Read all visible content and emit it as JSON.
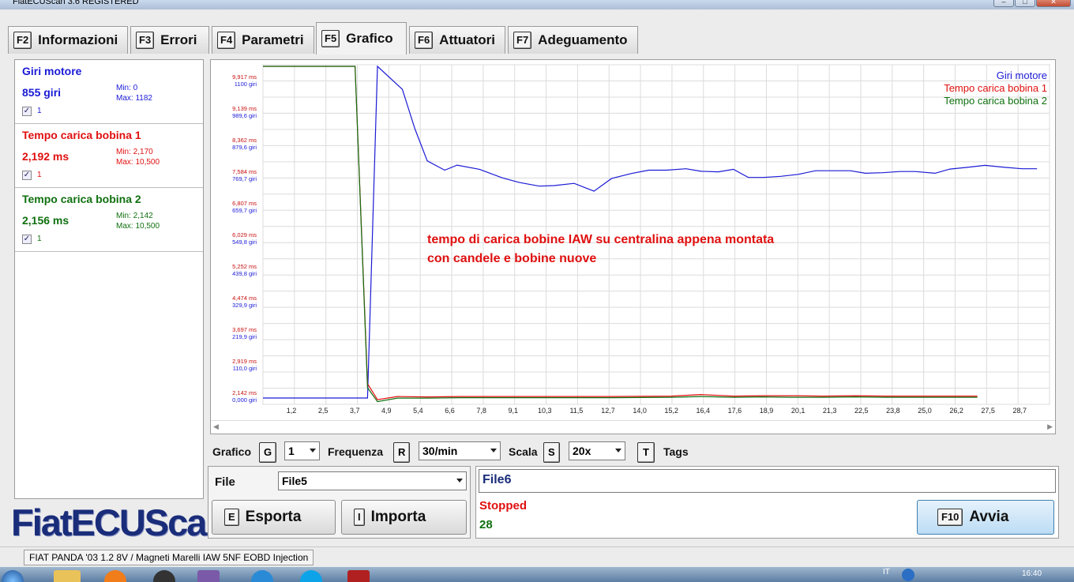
{
  "window": {
    "title": "FiatECUScan 3.6 REGISTERED",
    "min": "–",
    "max": "□",
    "close": "✕"
  },
  "tabs": [
    {
      "key": "F2",
      "label": "Informazioni"
    },
    {
      "key": "F3",
      "label": "Errori"
    },
    {
      "key": "F4",
      "label": "Parametri"
    },
    {
      "key": "F5",
      "label": "Grafico"
    },
    {
      "key": "F6",
      "label": "Attuatori"
    },
    {
      "key": "F7",
      "label": "Adeguamento"
    }
  ],
  "sensors": [
    {
      "name": "Giri motore",
      "value": "855 giri",
      "min": "Min: 0",
      "max": "Max: 1182",
      "color": "#1a1ad6",
      "checked": "1"
    },
    {
      "name": "Tempo carica bobina 1",
      "value": "2,192 ms",
      "min": "Min: 2,170",
      "max": "Max: 10,500",
      "color": "#e01010",
      "checked": "1"
    },
    {
      "name": "Tempo carica bobina 2",
      "value": "2,156 ms",
      "min": "Min: 2,142",
      "max": "Max: 10,500",
      "color": "#107010",
      "checked": "1"
    }
  ],
  "logo": "FiatECUScan",
  "chart_data": {
    "type": "line",
    "x_ticks": [
      "1,2",
      "2,5",
      "3,7",
      "4,9",
      "5,4",
      "6,6",
      "7,8",
      "9,1",
      "10,3",
      "11,5",
      "12,7",
      "14,0",
      "15,2",
      "16,4",
      "17,6",
      "18,9",
      "20,1",
      "21,3",
      "22,5",
      "23,8",
      "25,0",
      "26,2",
      "27,5",
      "28,7"
    ],
    "y_ticks_ms": [
      "2,142 ms",
      "2,919 ms",
      "3,697 ms",
      "4,474 ms",
      "5,252 ms",
      "6,029 ms",
      "6,807 ms",
      "7,584 ms",
      "8,362 ms",
      "9,139 ms",
      "9,917 ms"
    ],
    "y_ticks_rpm": [
      "0,000 giri",
      "110,0 giri",
      "219,9 giri",
      "329,9 giri",
      "439,8 giri",
      "549,8 giri",
      "659,7 giri",
      "769,7 giri",
      "879,6 giri",
      "989,6 giri",
      "1100 giri"
    ],
    "legend": [
      "Giri motore",
      "Tempo carica bobina 1",
      "Tempo carica bobina 2"
    ],
    "legend_colors": [
      "#1a1ad6",
      "#e01010",
      "#107010"
    ],
    "annotation": [
      "tempo di carica bobine IAW su centralina appena montata",
      "con candele e bobine nuove"
    ],
    "series": [
      {
        "name": "Giri motore",
        "color": "#1a1ad6",
        "points": [
          [
            0,
            0
          ],
          [
            3.7,
            0
          ],
          [
            4.2,
            0
          ],
          [
            4.6,
            1182
          ],
          [
            5.6,
            1100
          ],
          [
            6.1,
            960
          ],
          [
            6.6,
            845
          ],
          [
            7.3,
            812
          ],
          [
            7.8,
            830
          ],
          [
            8.7,
            815
          ],
          [
            9.6,
            785
          ],
          [
            10.3,
            768
          ],
          [
            11.1,
            755
          ],
          [
            11.7,
            757
          ],
          [
            12.5,
            765
          ],
          [
            13.3,
            737
          ],
          [
            14.0,
            782
          ],
          [
            14.8,
            800
          ],
          [
            15.5,
            812
          ],
          [
            16.2,
            812
          ],
          [
            17.0,
            817
          ],
          [
            17.6,
            808
          ],
          [
            18.3,
            806
          ],
          [
            18.9,
            815
          ],
          [
            19.5,
            786
          ],
          [
            20.1,
            786
          ],
          [
            20.8,
            790
          ],
          [
            21.5,
            797
          ],
          [
            22.2,
            810
          ],
          [
            22.8,
            810
          ],
          [
            23.6,
            810
          ],
          [
            24.2,
            801
          ],
          [
            24.9,
            803
          ],
          [
            25.6,
            807
          ],
          [
            26.2,
            807
          ],
          [
            27.0,
            801
          ],
          [
            27.6,
            816
          ],
          [
            28.3,
            822
          ],
          [
            29.0,
            829
          ],
          [
            29.8,
            822
          ],
          [
            30.5,
            817
          ],
          [
            31.1,
            817
          ]
        ]
      },
      {
        "name": "Tempo carica bobina 1",
        "color": "#e01010",
        "points": [
          [
            0,
            10.5
          ],
          [
            3.7,
            10.5
          ],
          [
            4.2,
            2.5
          ],
          [
            4.6,
            2.1
          ],
          [
            5.4,
            2.18
          ],
          [
            6.6,
            2.17
          ],
          [
            8.0,
            2.18
          ],
          [
            10.3,
            2.18
          ],
          [
            12.7,
            2.18
          ],
          [
            14.0,
            2.18
          ],
          [
            16.4,
            2.19
          ],
          [
            17.6,
            2.23
          ],
          [
            18.9,
            2.19
          ],
          [
            20.1,
            2.2
          ],
          [
            21.3,
            2.2
          ],
          [
            22.5,
            2.19
          ],
          [
            23.8,
            2.2
          ],
          [
            25.0,
            2.19
          ],
          [
            26.2,
            2.19
          ],
          [
            27.5,
            2.19
          ],
          [
            28.7,
            2.19
          ]
        ]
      },
      {
        "name": "Tempo carica bobina 2",
        "color": "#107010",
        "points": [
          [
            0,
            10.5
          ],
          [
            3.7,
            10.5
          ],
          [
            4.2,
            2.4
          ],
          [
            4.6,
            2.05
          ],
          [
            5.4,
            2.14
          ],
          [
            6.6,
            2.14
          ],
          [
            8.0,
            2.15
          ],
          [
            10.3,
            2.15
          ],
          [
            12.7,
            2.15
          ],
          [
            14.0,
            2.15
          ],
          [
            16.4,
            2.16
          ],
          [
            17.6,
            2.18
          ],
          [
            18.9,
            2.16
          ],
          [
            20.1,
            2.17
          ],
          [
            21.3,
            2.16
          ],
          [
            22.5,
            2.16
          ],
          [
            23.8,
            2.17
          ],
          [
            25.0,
            2.16
          ],
          [
            26.2,
            2.16
          ],
          [
            27.5,
            2.16
          ],
          [
            28.7,
            2.16
          ]
        ]
      }
    ],
    "x_range": [
      0,
      31.6
    ],
    "ms_range": [
      2.142,
      10.5
    ],
    "rpm_range": [
      0,
      1182
    ]
  },
  "controls": {
    "grafico_label": "Grafico",
    "grafico_key": "G",
    "grafico_value": "1",
    "frequenza_label": "Frequenza",
    "frequenza_key": "R",
    "frequenza_value": "30/min",
    "scala_label": "Scala",
    "scala_key": "S",
    "scala_value": "20x",
    "tags_key": "T",
    "tags_label": "Tags"
  },
  "file": {
    "label": "File",
    "value": "File5",
    "export_key": "E",
    "export_label": "Esporta",
    "import_key": "I",
    "import_label": "Importa"
  },
  "run": {
    "file_name": "File6",
    "status": "Stopped",
    "count": "28",
    "start_key": "F10",
    "start_label": "Avvia"
  },
  "status": {
    "vehicle": "FIAT PANDA '03 1.2 8V / Magneti Marelli IAW 5NF EOBD Injection"
  },
  "taskbar": {
    "lang": "IT",
    "clock": "16:40"
  }
}
